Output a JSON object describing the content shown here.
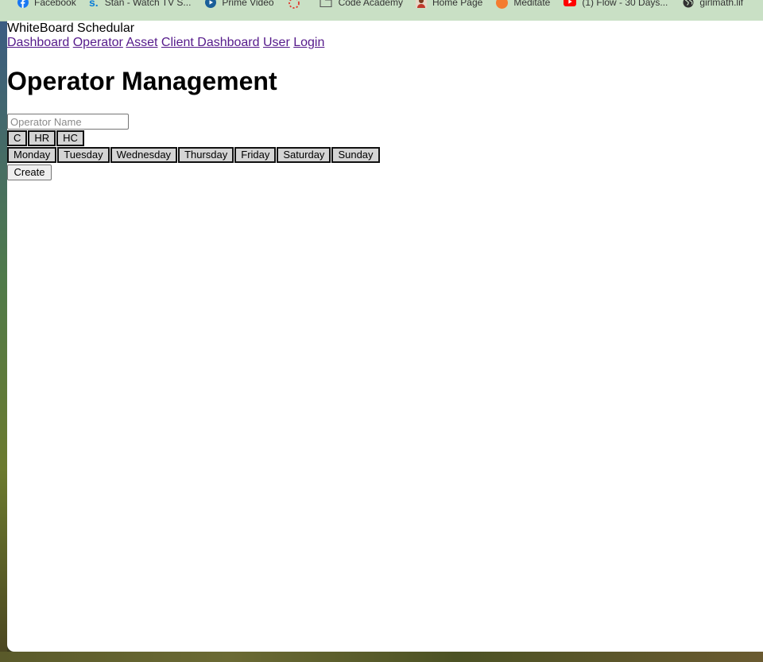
{
  "bookmarks": [
    {
      "label": "Facebook",
      "icon": "facebook-icon",
      "color": "#1877f2"
    },
    {
      "label": "Stan - Watch TV S...",
      "icon": "stan-icon",
      "color": "#0b7dd6"
    },
    {
      "label": "Prime Video",
      "icon": "prime-video-icon",
      "color": "#1a5f99"
    },
    {
      "label": "",
      "icon": "loading-spinner-icon",
      "color": "#e03a2f"
    },
    {
      "label": "Code Academy",
      "icon": "folder-icon",
      "color": "#555555"
    },
    {
      "label": "Home Page",
      "icon": "profile-image-icon",
      "color": "#a0522d"
    },
    {
      "label": "Meditate",
      "icon": "meditate-icon",
      "color": "#f47c30"
    },
    {
      "label": "(1) Flow - 30 Days...",
      "icon": "youtube-icon",
      "color": "#ff0000"
    },
    {
      "label": "girlmath.lif",
      "icon": "globe-icon",
      "color": "#333333"
    }
  ],
  "app": {
    "title": "WhiteBoard Schedular"
  },
  "nav": {
    "links": [
      "Dashboard",
      "Operator",
      "Asset",
      "Client Dashboard",
      "User",
      "Login"
    ]
  },
  "main": {
    "heading": "Operator Management",
    "name_placeholder": "Operator Name",
    "name_value": "",
    "type_buttons": [
      "C",
      "HR",
      "HC"
    ],
    "day_buttons": [
      "Monday",
      "Tuesday",
      "Wednesday",
      "Thursday",
      "Friday",
      "Saturday",
      "Sunday"
    ],
    "create_label": "Create"
  }
}
